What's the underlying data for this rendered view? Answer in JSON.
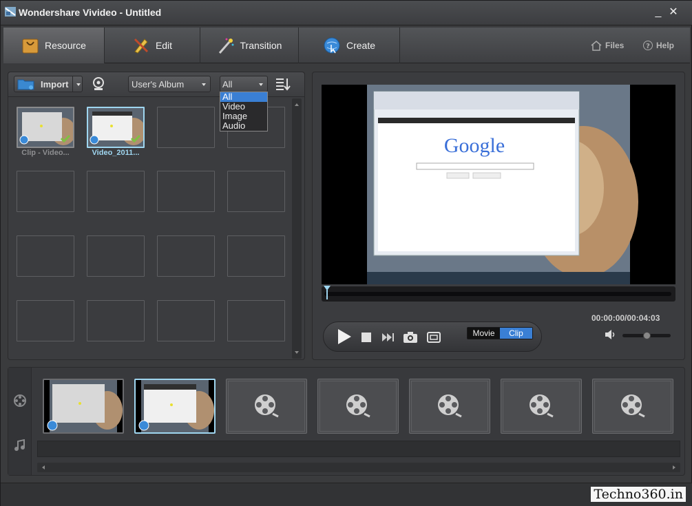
{
  "window": {
    "title": "Wondershare Vivideo - Untitled",
    "minimize": "_",
    "close": "✕"
  },
  "tabs": [
    {
      "label": "Resource",
      "icon": "bag-icon"
    },
    {
      "label": "Edit",
      "icon": "pencil-ruler-icon"
    },
    {
      "label": "Transition",
      "icon": "magic-wand-icon"
    },
    {
      "label": "Create",
      "icon": "globe-arrow-icon"
    }
  ],
  "top_links": {
    "files": "Files",
    "help": "Help"
  },
  "resource": {
    "import_label": "Import",
    "album_label": "User's Album",
    "filter_selected": "All",
    "filter_options": [
      "All",
      "Video",
      "Image",
      "Audio"
    ],
    "items": [
      {
        "label": "Clip - Video..."
      },
      {
        "label": "Video_2011..."
      }
    ]
  },
  "preview": {
    "time": "00:00:00/00:04:03",
    "mode_movie": "Movie",
    "mode_clip": "Clip",
    "google_text": "Google"
  },
  "watermark": "Techno360.in",
  "colors": {
    "accent": "#3a7fd4",
    "selection": "#9fd6f0",
    "check": "#7fc241"
  }
}
